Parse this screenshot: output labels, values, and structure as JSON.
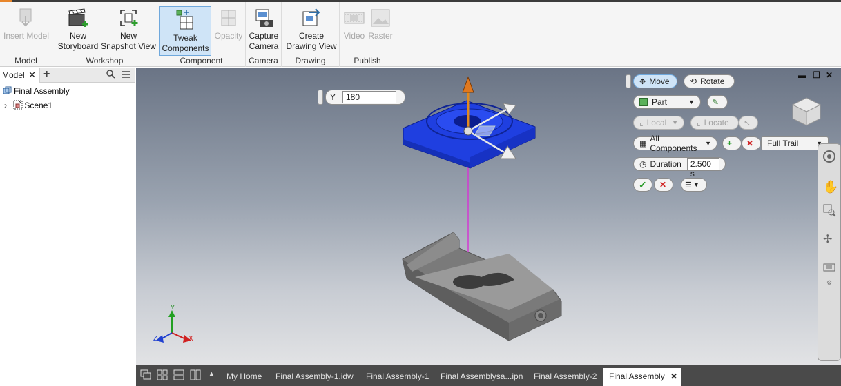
{
  "ribbon": {
    "groups": {
      "model": "Model",
      "workshop": "Workshop",
      "component": "Component",
      "camera": "Camera",
      "drawing": "Drawing",
      "publish": "Publish"
    },
    "buttons": {
      "insert_model": [
        "Insert Model",
        ""
      ],
      "new_storyboard": [
        "New",
        "Storyboard"
      ],
      "new_snapshot": [
        "New",
        "Snapshot View"
      ],
      "tweak": [
        "Tweak",
        "Components"
      ],
      "opacity": [
        "Opacity",
        ""
      ],
      "capture": [
        "Capture",
        "Camera"
      ],
      "create_drawing": [
        "Create",
        "Drawing View"
      ],
      "video": [
        "Video",
        ""
      ],
      "raster": [
        "Raster",
        ""
      ]
    },
    "accent_color": "#e8862b"
  },
  "browser": {
    "tab_label": "Model",
    "tree": [
      {
        "label": "Final Assembly"
      },
      {
        "label": "Scene1"
      }
    ]
  },
  "viewport": {
    "axis_field": {
      "axis": "Y",
      "value": "180"
    },
    "tweak_panel": {
      "move": "Move",
      "rotate": "Rotate",
      "selection_filter": "Part",
      "local": "Local",
      "locate": "Locate",
      "components_filter": "All Components",
      "trail": "Full Trail",
      "duration_label": "Duration",
      "duration_value": "2.500 s"
    },
    "triad": {
      "x": "X",
      "y": "Y",
      "z": "Z"
    },
    "highlight_color": "#1f3fe0"
  },
  "doc_tabs": [
    {
      "label": "My Home"
    },
    {
      "label": "Final Assembly-1.idw"
    },
    {
      "label": "Final Assembly-1"
    },
    {
      "label": "Final Assemblysa...ipn"
    },
    {
      "label": "Final Assembly-2"
    },
    {
      "label": "Final Assembly",
      "active": true
    }
  ]
}
